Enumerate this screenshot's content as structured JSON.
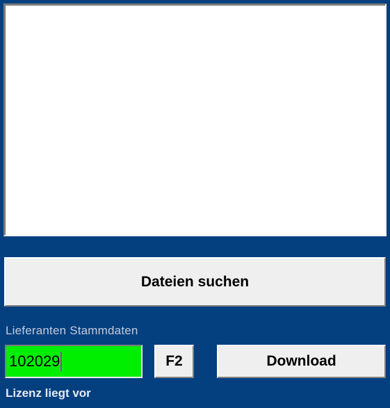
{
  "window": {
    "background_color": "#044080"
  },
  "file_list": {
    "items": [],
    "empty": true,
    "background_color": "#ffffff"
  },
  "search_button": {
    "label": "Dateien suchen"
  },
  "supplier_section": {
    "label": "Lieferanten Stammdaten",
    "input": {
      "value": "102029",
      "placeholder": "",
      "background_color": "#00ee00",
      "text_color": "#000000",
      "caret_color": "#cc22cc"
    },
    "f2_button": {
      "label": "F2"
    },
    "download_button": {
      "label": "Download"
    }
  },
  "status": {
    "text": "Lizenz liegt vor",
    "text_color": "#e6eaf2"
  }
}
